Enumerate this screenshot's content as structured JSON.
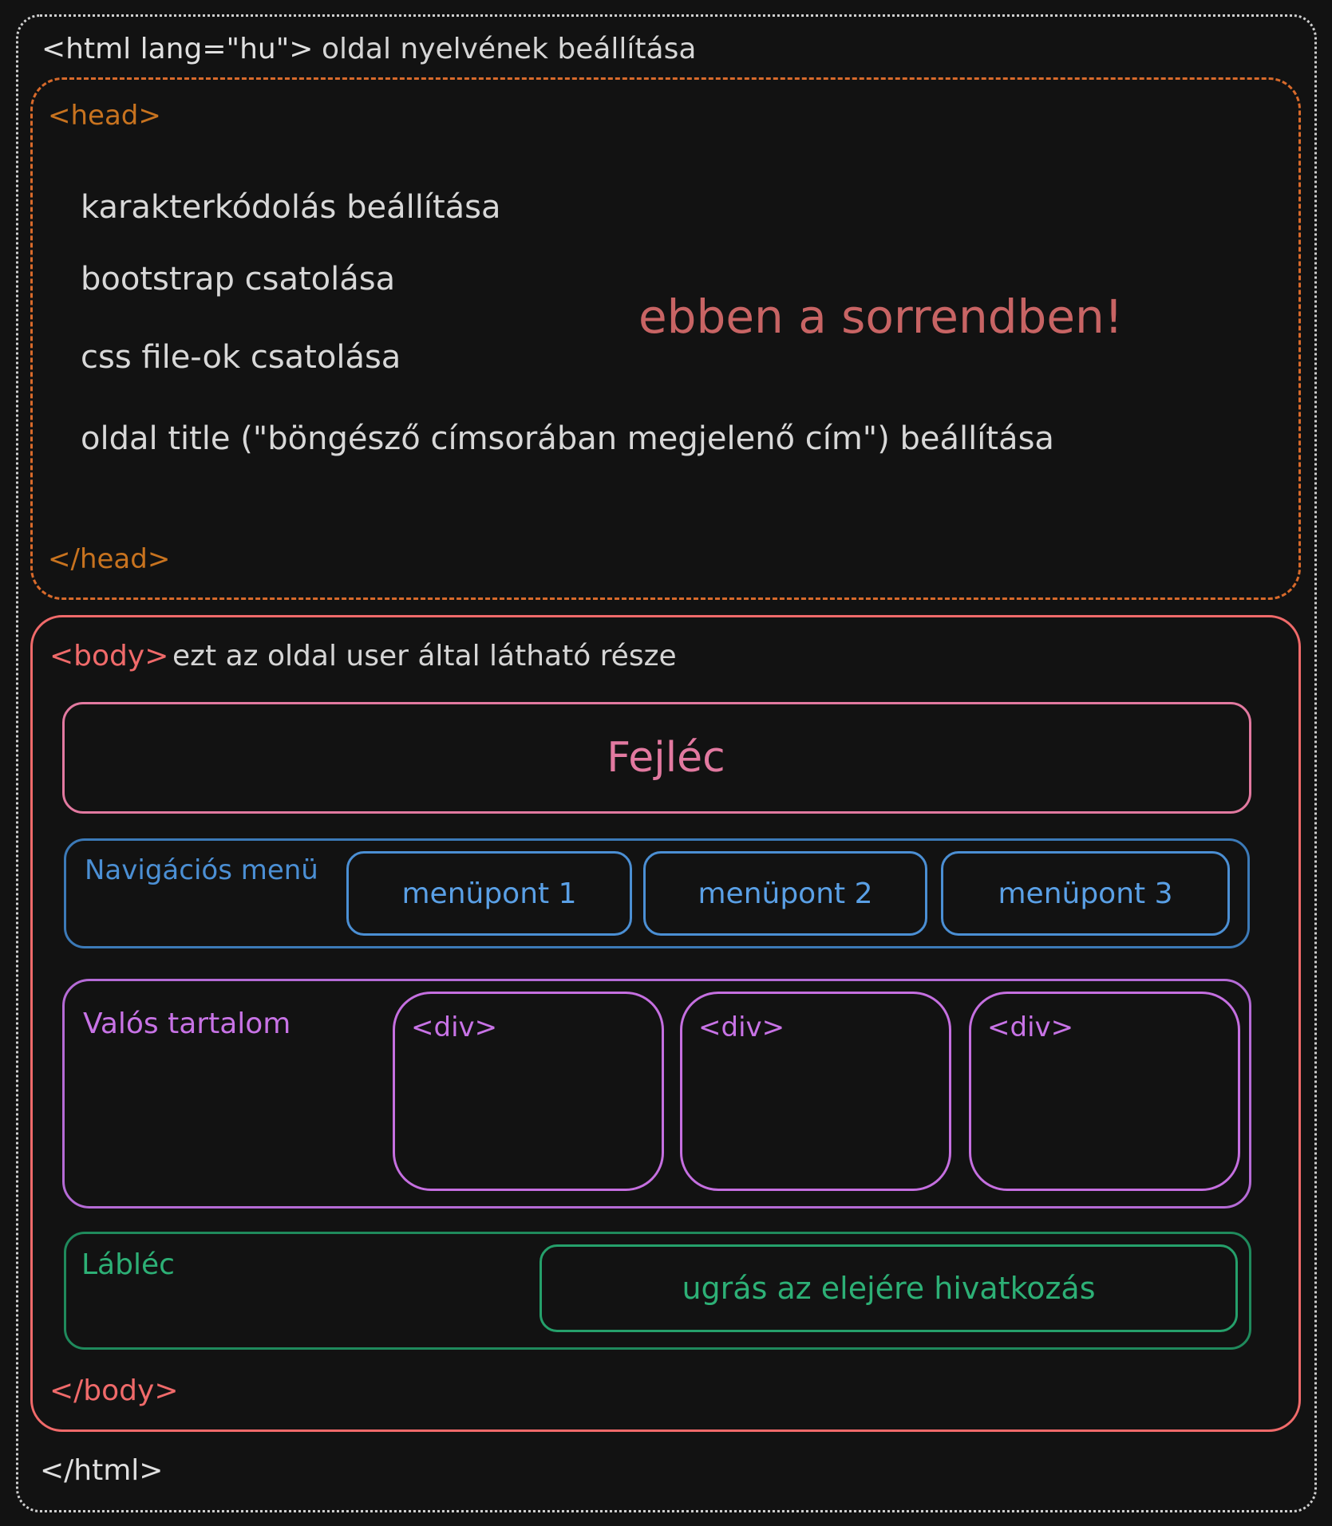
{
  "html": {
    "open_tag": "<html lang=\"hu\">",
    "note": "oldal nyelvének beállítása",
    "close_tag": "</html>"
  },
  "head": {
    "open_tag": "<head>",
    "close_tag": "</head>",
    "items": [
      "karakterkódolás beállítása",
      "bootstrap csatolása",
      "css file-ok csatolása",
      "oldal title (\"böngésző címsorában megjelenő cím\") beállítása"
    ],
    "order_note": "ebben a sorrendben!"
  },
  "body": {
    "open_tag": "<body>",
    "note": "ezt az oldal user által látható része",
    "close_tag": "</body>",
    "header": {
      "label": "Fejléc"
    },
    "nav": {
      "label": "Navigációs menü",
      "items": [
        "menüpont 1",
        "menüpont 2",
        "menüpont 3"
      ]
    },
    "content": {
      "label": "Valós tartalom",
      "divs": [
        "<div>",
        "<div>",
        "<div>"
      ]
    },
    "footer": {
      "label": "Lábléc",
      "link": "ugrás az elejére hivatkozás"
    }
  },
  "colors": {
    "background": "#121212",
    "html_frame": "#cfcfcf",
    "head_frame": "#d86a2b",
    "head_tag": "#c8731f",
    "order_note": "#c86464",
    "body_frame": "#f06a6a",
    "header": "#e279a0",
    "nav": "#3c7ab8",
    "content": "#b56bd6",
    "footer": "#1f8a5c"
  }
}
